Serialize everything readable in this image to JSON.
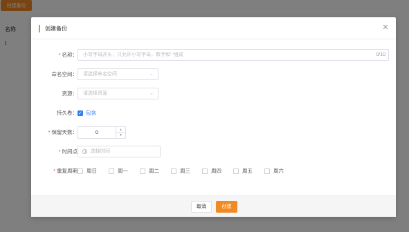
{
  "background": {
    "create_button": "创建备份",
    "table_header": "名称",
    "table_cell": "t"
  },
  "dialog": {
    "title": "创建备份",
    "close_icon": "close-icon",
    "accent_color": "#f08a24",
    "fields": {
      "name": {
        "label": "名称：",
        "required": "*",
        "placeholder": "小写字母开头，只允许小写字母，数字和'-'组成",
        "counter": "0/10"
      },
      "namespace": {
        "label": "命名空间：",
        "placeholder": "请选择命名空间"
      },
      "resource": {
        "label": "资源：",
        "placeholder": "请选择资源"
      },
      "persistent_volume": {
        "label": "持久卷：",
        "checkbox_label": "包含",
        "checked": true
      },
      "retention_days": {
        "label": "保留天数：",
        "required": "*",
        "value": "0"
      },
      "time_point": {
        "label": "时间点",
        "required": "*",
        "placeholder": "选择时间"
      },
      "repeat_cycle": {
        "label": "重复周期",
        "required": "*",
        "days": [
          "周日",
          "周一",
          "周二",
          "周三",
          "周四",
          "周五",
          "周六"
        ]
      }
    },
    "footer": {
      "cancel": "取消",
      "create": "创建"
    }
  }
}
